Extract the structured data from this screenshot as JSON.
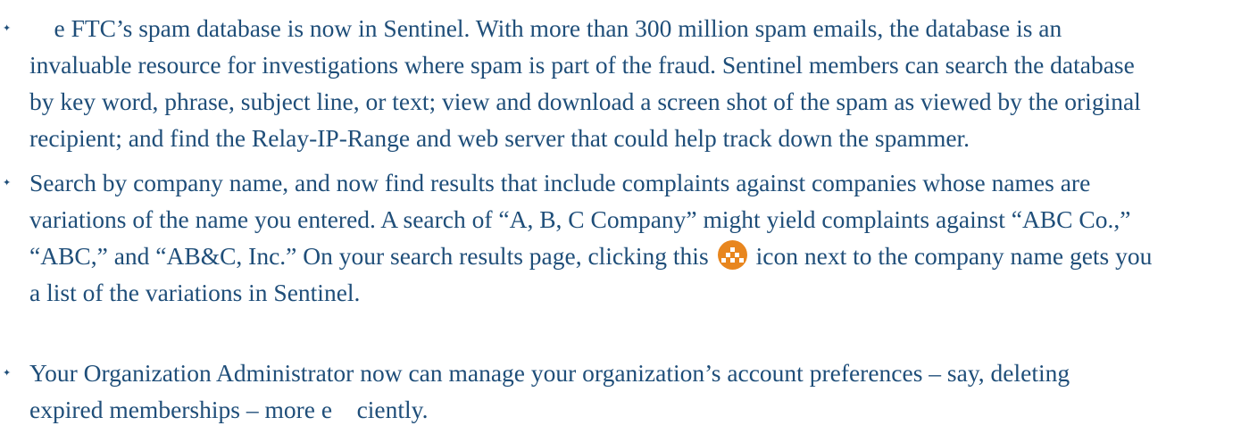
{
  "bullet_glyph": "✦",
  "items": [
    {
      "lines": [
        "    e FTC’s spam database is now in Sentinel. With more than 300 million spam emails, the database is an",
        "invaluable resource for investigations where spam is part of the fraud. Sentinel members can search the database",
        "by key word, phrase, subject line, or text; view and download a screen shot of the spam as viewed by the original",
        "recipient; and find the Relay-IP-Range and web server that could help track down the spammer."
      ]
    },
    {
      "lines": [
        "Search by company name, and now find results that include complaints against companies whose names are",
        "variations of the name you entered. A search of “A, B, C Company” might yield complaints against “ABC Co.,”",
        "“ABC,” and “AB&C, Inc.” On your search results page, clicking this",
        "icon next to the company name gets you",
        "a list of the variations in Sentinel."
      ]
    },
    {
      "lines": [
        "Your Organization Administrator now can manage your organization’s account preferences – say, deleting",
        "expired memberships – more e    ciently."
      ]
    }
  ],
  "icon": {
    "name": "company-variations-icon",
    "color": "#e8861e"
  }
}
